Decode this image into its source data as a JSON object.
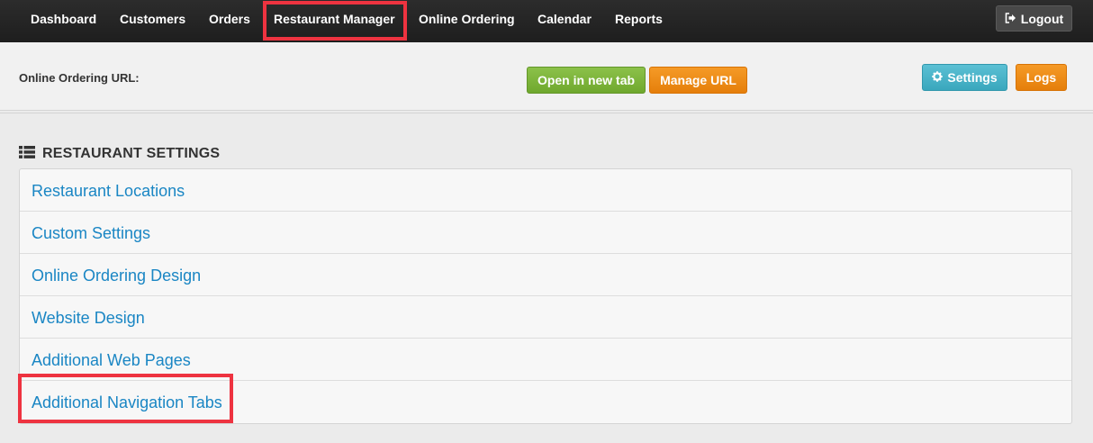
{
  "nav": {
    "items": [
      "Dashboard",
      "Customers",
      "Orders",
      "Restaurant Manager",
      "Online Ordering",
      "Calendar",
      "Reports"
    ],
    "active": "Restaurant Manager",
    "logout_label": "Logout",
    "logout_icon": "sign-out-icon"
  },
  "urlbar": {
    "label": "Online Ordering URL:",
    "open_new_tab_label": "Open in new tab",
    "manage_url_label": "Manage URL",
    "settings_label": "Settings",
    "settings_icon": "gear-icon",
    "logs_label": "Logs"
  },
  "section": {
    "title": "RESTAURANT SETTINGS",
    "icon": "list-icon",
    "items": [
      "Restaurant Locations",
      "Custom Settings",
      "Online Ordering Design",
      "Website Design",
      "Additional Web Pages",
      "Additional Navigation Tabs"
    ],
    "highlighted": "Additional Navigation Tabs"
  },
  "colors": {
    "nav_bg": "#222222",
    "highlight": "#ee3340",
    "green": "#7ab53a",
    "orange": "#f08a14",
    "teal": "#4ab4c9",
    "link": "#1a86c4"
  }
}
